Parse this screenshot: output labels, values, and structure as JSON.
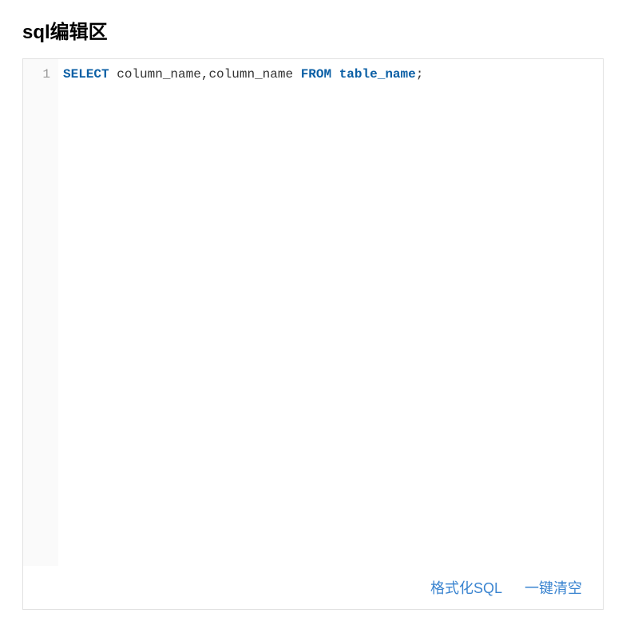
{
  "title": "sql编辑区",
  "editor": {
    "lines": [
      {
        "number": "1",
        "tokens": [
          {
            "type": "keyword",
            "text": "SELECT"
          },
          {
            "type": "space",
            "text": " "
          },
          {
            "type": "ident",
            "text": "column_name"
          },
          {
            "type": "punct",
            "text": ","
          },
          {
            "type": "ident",
            "text": "column_name"
          },
          {
            "type": "space",
            "text": " "
          },
          {
            "type": "keyword",
            "text": "FROM"
          },
          {
            "type": "space",
            "text": " "
          },
          {
            "type": "keyword",
            "text": "table_name"
          },
          {
            "type": "punct",
            "text": ";"
          }
        ]
      }
    ]
  },
  "buttons": {
    "format_label": "格式化SQL",
    "clear_label": "一键清空"
  }
}
